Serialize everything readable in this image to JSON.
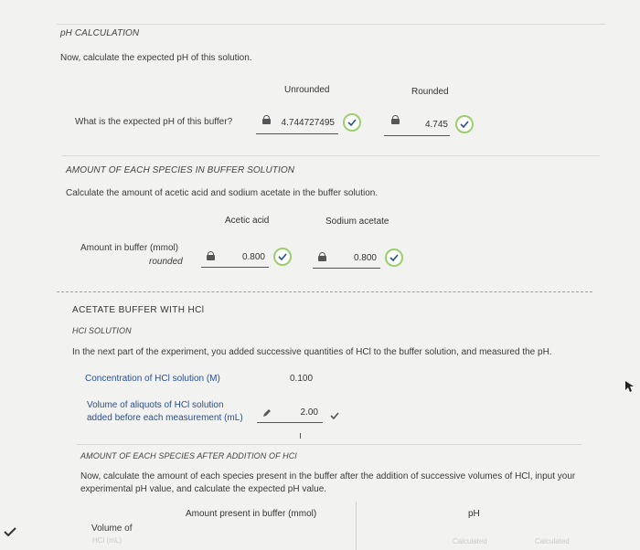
{
  "ph_section": {
    "heading": "pH CALCULATION",
    "instruction": "Now, calculate the expected pH of this solution.",
    "col_unrounded": "Unrounded",
    "col_rounded": "Rounded",
    "question": "What is the expected pH of this buffer?",
    "unrounded_value": "4.744727495",
    "rounded_value": "4.745"
  },
  "species_section": {
    "heading": "AMOUNT OF EACH SPECIES IN BUFFER SOLUTION",
    "instruction": "Calculate the amount of acetic acid and sodium acetate in the buffer solution.",
    "col_acetic": "Acetic acid",
    "col_sodium": "Sodium acetate",
    "row_label": "Amount in buffer (mmol)",
    "row_sublabel": "rounded",
    "acetic_value": "0.800",
    "sodium_value": "0.800"
  },
  "hcl_section": {
    "heading": "ACETATE BUFFER WITH HCl",
    "subheading": "HCl SOLUTION",
    "instruction": "In the next part of the experiment, you added successive quantities of HCl to the buffer solution, and measured the pH.",
    "conc_label": "Concentration of HCl solution (M)",
    "conc_value": "0.100",
    "volume_label_1": "Volume of aliquots of HCl solution",
    "volume_label_2": "added before each measurement (mL)",
    "volume_value": "2.00"
  },
  "after_section": {
    "heading": "AMOUNT OF EACH SPECIES AFTER ADDITION OF HCl",
    "instruction_1": "Now, calculate the amount of each species present in the buffer after the addition of successive volumes of HCl, input your",
    "instruction_2": "experimental pH value, and calculate the expected pH value.",
    "col_amount": "Amount present in buffer (mmol)",
    "col_ph": "pH",
    "row_label": "Volume of",
    "row_sublabel": "HCl (mL)",
    "calc_1": "Calculated",
    "calc_2": "Calculated"
  },
  "colors": {
    "accent_green": "#9bcf6b",
    "link_blue": "#2a4f8c"
  }
}
